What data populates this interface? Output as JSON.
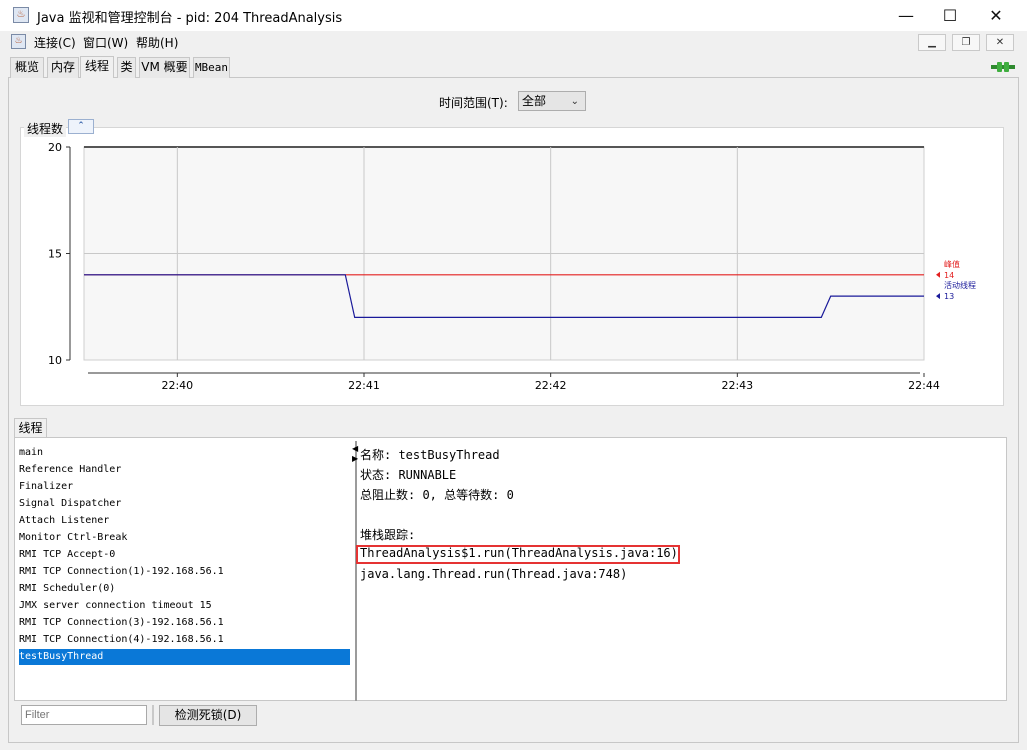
{
  "window": {
    "title": "Java 监视和管理控制台 - pid: 204 ThreadAnalysis",
    "minimize_glyph": "—",
    "maximize_glyph": "☐",
    "close_glyph": "✕"
  },
  "menu": {
    "items": [
      "连接(C)",
      "窗口(W)",
      "帮助(H)"
    ],
    "mdi_minimize": "▁",
    "mdi_restore": "❐",
    "mdi_close": "✕"
  },
  "tabs": [
    "概览",
    "内存",
    "线程",
    "类",
    "VM 概要",
    "MBean"
  ],
  "active_tab": "线程",
  "time_range": {
    "label": "时间范围(T):",
    "selected": "全部"
  },
  "chart_panel": {
    "title": "线程数",
    "collapse_glyph": "⌃"
  },
  "chart_data": {
    "type": "line",
    "title": "线程数",
    "xlabel": "",
    "ylabel": "",
    "ylim": [
      10,
      20
    ],
    "yticks": [
      "10",
      "15",
      "20"
    ],
    "xticks": [
      "22:40",
      "22:41",
      "22:42",
      "22:43",
      "22:44"
    ],
    "grid": true,
    "series": [
      {
        "name": "峰值",
        "color": "#e32020",
        "current": "14",
        "points": [
          [
            "22:39.5",
            14
          ],
          [
            "22:44",
            14
          ]
        ]
      },
      {
        "name": "活动线程",
        "color": "#1a1a9a",
        "current": "13",
        "points": [
          [
            "22:39.5",
            14
          ],
          [
            "22:40.9",
            14
          ],
          [
            "22:40.95",
            12
          ],
          [
            "22:43.45",
            12
          ],
          [
            "22:43.5",
            13
          ],
          [
            "22:44",
            13
          ]
        ]
      }
    ]
  },
  "threads_section": {
    "tab_label": "线程",
    "items": [
      "main",
      "Reference Handler",
      "Finalizer",
      "Signal Dispatcher",
      "Attach Listener",
      "Monitor Ctrl-Break",
      "RMI TCP Accept-0",
      "RMI TCP Connection(1)-192.168.56.1",
      "RMI Scheduler(0)",
      "JMX server connection timeout 15",
      "RMI TCP Connection(3)-192.168.56.1",
      "RMI TCP Connection(4)-192.168.56.1",
      "testBusyThread"
    ],
    "selected": "testBusyThread"
  },
  "thread_detail": {
    "name_line": "名称: testBusyThread",
    "state_line": "状态: RUNNABLE",
    "counts_line": "总阻止数: 0, 总等待数: 0",
    "stack_label": "堆栈跟踪:",
    "stack": [
      "ThreadAnalysis$1.run(ThreadAnalysis.java:16)",
      "java.lang.Thread.run(Thread.java:748)"
    ]
  },
  "bottom": {
    "filter_placeholder": "Filter",
    "deadlock_button": "检测死锁(D)"
  }
}
